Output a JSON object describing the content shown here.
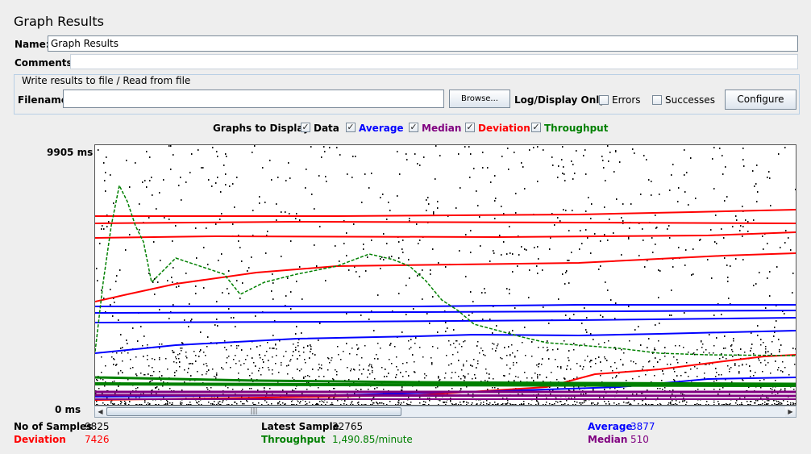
{
  "panel": {
    "title": "Graph Results"
  },
  "name_field": {
    "label": "Name:",
    "value": "Graph Results"
  },
  "comments_field": {
    "label": "Comments:",
    "value": ""
  },
  "file_group": {
    "title": "Write results to file / Read from file",
    "filename_label": "Filename",
    "filename_value": "",
    "browse_label": "Browse...",
    "log_display_label": "Log/Display Only:",
    "errors_label": "Errors",
    "successes_label": "Successes",
    "configure_label": "Configure",
    "errors_checked": false,
    "successes_checked": false
  },
  "graphs_to_display": {
    "label": "Graphs to Display",
    "options": [
      {
        "label": "Data",
        "checked": true,
        "color": "#000000"
      },
      {
        "label": "Average",
        "checked": true,
        "color": "#0000ff"
      },
      {
        "label": "Median",
        "checked": true,
        "color": "#800080"
      },
      {
        "label": "Deviation",
        "checked": true,
        "color": "#ff0000"
      },
      {
        "label": "Throughput",
        "checked": true,
        "color": "#008000"
      }
    ]
  },
  "graph": {
    "y_max_label": "9905 ms",
    "y_min_label": "0 ms",
    "colors": {
      "data": "#000000",
      "average": "#0000ff",
      "median": "#800080",
      "deviation": "#ff0000",
      "throughput": "#008000"
    }
  },
  "stats": {
    "samples_label": "No of Samples",
    "samples_value": "9825",
    "latest_label": "Latest Sample",
    "latest_value": "32765",
    "average_label": "Average",
    "average_value": "3877",
    "deviation_label": "Deviation",
    "deviation_value": "7426",
    "throughput_label": "Throughput",
    "throughput_value": "1,490.85/minute",
    "median_label": "Median",
    "median_value": "510"
  }
}
